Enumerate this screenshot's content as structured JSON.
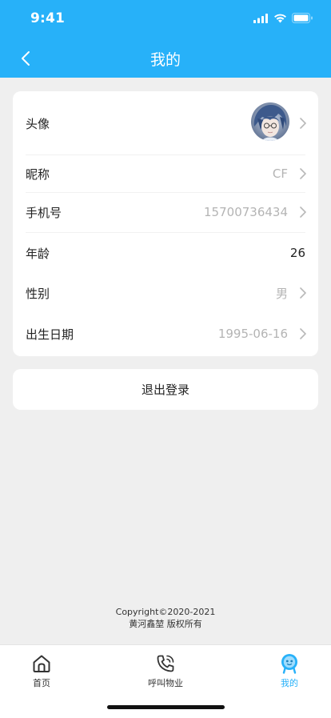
{
  "status_bar": {
    "time": "9:41"
  },
  "nav": {
    "title": "我的"
  },
  "profile": {
    "rows": [
      {
        "label": "头像"
      },
      {
        "label": "昵称",
        "value": "CF"
      },
      {
        "label": "手机号",
        "value": "15700736434"
      },
      {
        "label": "年龄",
        "value": "26"
      },
      {
        "label": "性别",
        "value": "男"
      },
      {
        "label": "出生日期",
        "value": "1995-06-16"
      }
    ]
  },
  "logout": {
    "label": "退出登录"
  },
  "footer": {
    "copyright": "Copyright©2020-2021",
    "owner": "黄河鑫堃 版权所有"
  },
  "tabbar": {
    "tabs": [
      {
        "label": "首页",
        "icon": "home-icon"
      },
      {
        "label": "呼叫物业",
        "icon": "phone-icon"
      },
      {
        "label": "我的",
        "icon": "profile-icon"
      }
    ],
    "active_index": 2
  },
  "colors": {
    "primary": "#27b1f9",
    "background": "#efefef",
    "muted_text": "#b4b4b4"
  }
}
